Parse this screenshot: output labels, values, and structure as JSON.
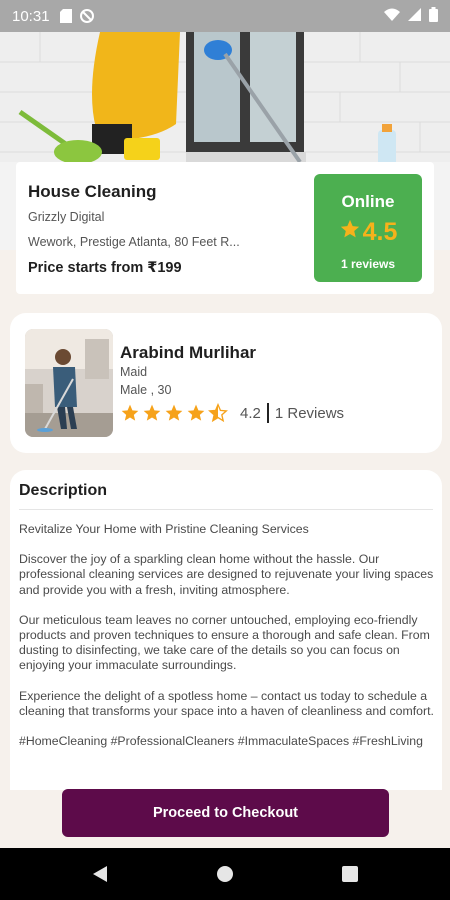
{
  "status_bar": {
    "time": "10:31"
  },
  "service": {
    "title": "House Cleaning",
    "company": "Grizzly Digital",
    "address": "Wework, Prestige Atlanta, 80 Feet R...",
    "price": "Price starts from ₹199",
    "status": "Online",
    "rating": "4.5",
    "reviews": "1 reviews",
    "status_color": "#4caf50",
    "rating_color": "#f6b21b"
  },
  "provider": {
    "name": "Arabind Murlihar",
    "role": "Maid",
    "gender_age": "Male , 30",
    "rating": "4.2",
    "rating_stars": 4.2,
    "reviews": "1 Reviews"
  },
  "description": {
    "title": "Description",
    "paragraphs": [
      "Revitalize Your Home with Pristine Cleaning Services",
      "Discover the joy of a sparkling clean home without the hassle. Our professional cleaning services are designed to rejuvenate your living spaces and provide you with a fresh, inviting atmosphere.",
      "Our meticulous team leaves no corner untouched, employing eco-friendly products and proven techniques to ensure a thorough and safe clean. From dusting to disinfecting, we take care of the details so you can focus on enjoying your immaculate surroundings.",
      "Experience the delight of a spotless home – contact us today to schedule a cleaning that transforms your space into a haven of cleanliness and comfort.",
      "#HomeCleaning #ProfessionalCleaners #ImmaculateSpaces #FreshLiving"
    ]
  },
  "checkout": {
    "label": "Proceed to Checkout",
    "color": "#5d0b4a"
  },
  "nav": {
    "back_icon": "back-triangle",
    "home_icon": "home-circle",
    "recents_icon": "recents-square"
  }
}
